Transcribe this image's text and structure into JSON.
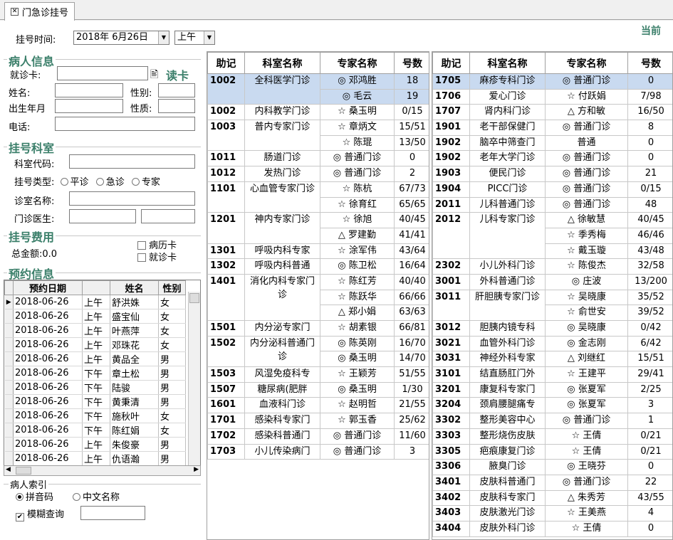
{
  "tab": {
    "title": "门急诊挂号"
  },
  "header": {
    "time_label": "挂号时间:",
    "date_value": "2018年  6月26日",
    "period_value": "上午",
    "current_label": "当前"
  },
  "patient": {
    "title": "病人信息",
    "card_label": "就诊卡:",
    "read_card": "读卡",
    "name_label": "姓名:",
    "gender_label": "性别:",
    "birth_label": "出生年月",
    "nature_label": "性质:",
    "phone_label": "电话:"
  },
  "dept": {
    "title": "挂号科室",
    "code_label": "科室代码:",
    "type_label": "挂号类型:",
    "type_options": [
      "平诊",
      "急诊",
      "专家"
    ],
    "room_label": "诊室名称:",
    "doctor_label": "门诊医生:"
  },
  "fee": {
    "title": "挂号费用",
    "total_label": "总金额:0.0",
    "chk_record": "病历卡",
    "chk_card": "就诊卡"
  },
  "appointment": {
    "title": "预约信息",
    "columns": [
      "预约日期",
      "",
      "姓名",
      "性别"
    ],
    "rows": [
      [
        "2018-06-26",
        "上午",
        "舒洪姝",
        "女"
      ],
      [
        "2018-06-26",
        "上午",
        "盛宝仙",
        "女"
      ],
      [
        "2018-06-26",
        "上午",
        "叶燕萍",
        "女"
      ],
      [
        "2018-06-26",
        "上午",
        "邓珠花",
        "女"
      ],
      [
        "2018-06-26",
        "上午",
        "黄品全",
        "男"
      ],
      [
        "2018-06-26",
        "下午",
        "章土松",
        "男"
      ],
      [
        "2018-06-26",
        "下午",
        "陆骏",
        "男"
      ],
      [
        "2018-06-26",
        "下午",
        "黄秉清",
        "男"
      ],
      [
        "2018-06-26",
        "下午",
        "施秋叶",
        "女"
      ],
      [
        "2018-06-26",
        "下午",
        "陈红娟",
        "女"
      ],
      [
        "2018-06-26",
        "上午",
        "朱俊豪",
        "男"
      ],
      [
        "2018-06-26",
        "上午",
        "仇语瀚",
        "男"
      ]
    ]
  },
  "index": {
    "title": "病人索引",
    "opt_pinyin": "拼音码",
    "opt_chinese": "中文名称",
    "fuzzy": "模糊查询"
  },
  "grid_headers": [
    "助记",
    "科室名称",
    "专家名称",
    "号数"
  ],
  "grid_left": [
    {
      "code": "1002",
      "dept": "全科医学门诊",
      "docs": [
        [
          "◎ 邓鸿胜",
          "18"
        ],
        [
          "◎ 毛云",
          "19"
        ]
      ],
      "sel": true
    },
    {
      "code": "1002",
      "dept": "内科教学门诊",
      "docs": [
        [
          "☆ 桑玉明",
          "0/15"
        ]
      ]
    },
    {
      "code": "1003",
      "dept": "普内专家门诊",
      "docs": [
        [
          "☆ 章炳文",
          "15/51"
        ],
        [
          "☆ 陈琨",
          "13/50"
        ]
      ]
    },
    {
      "code": "1011",
      "dept": "肠道门诊",
      "docs": [
        [
          "◎ 普通门诊",
          "0"
        ]
      ]
    },
    {
      "code": "1012",
      "dept": "发热门诊",
      "docs": [
        [
          "◎ 普通门诊",
          "2"
        ]
      ]
    },
    {
      "code": "1101",
      "dept": "心血管专家门诊",
      "docs": [
        [
          "☆ 陈杭",
          "67/73"
        ],
        [
          "☆ 徐育红",
          "65/65"
        ]
      ]
    },
    {
      "code": "1201",
      "dept": "神内专家门诊",
      "docs": [
        [
          "☆ 徐旭",
          "40/45"
        ],
        [
          "△ 罗建勤",
          "41/41"
        ]
      ]
    },
    {
      "code": "1301",
      "dept": "呼吸内科专家",
      "docs": [
        [
          "☆ 涂军伟",
          "43/64"
        ]
      ]
    },
    {
      "code": "1302",
      "dept": "呼吸内科普通",
      "docs": [
        [
          "◎ 陈卫松",
          "16/64"
        ]
      ]
    },
    {
      "code": "1401",
      "dept": "消化内科专家门诊",
      "docs": [
        [
          "☆ 陈红芳",
          "40/40"
        ],
        [
          "☆ 陈跃华",
          "66/66"
        ],
        [
          "△ 郑小娟",
          "63/63"
        ]
      ]
    },
    {
      "code": "1501",
      "dept": "内分泌专家门",
      "docs": [
        [
          "☆ 胡素银",
          "66/81"
        ]
      ]
    },
    {
      "code": "1502",
      "dept": "内分泌科普通门诊",
      "docs": [
        [
          "◎ 陈英刚",
          "16/70"
        ],
        [
          "◎ 桑玉明",
          "14/70"
        ]
      ]
    },
    {
      "code": "1503",
      "dept": "风湿免疫科专",
      "docs": [
        [
          "☆ 王颖芳",
          "51/55"
        ]
      ]
    },
    {
      "code": "1507",
      "dept": "糖尿病(肥胖",
      "docs": [
        [
          "◎ 桑玉明",
          "1/30"
        ]
      ]
    },
    {
      "code": "1601",
      "dept": "血液科门诊",
      "docs": [
        [
          "☆ 赵明哲",
          "21/55"
        ]
      ]
    },
    {
      "code": "1701",
      "dept": "感染科专家门",
      "docs": [
        [
          "☆ 郭玉香",
          "25/62"
        ]
      ]
    },
    {
      "code": "1702",
      "dept": "感染科普通门",
      "docs": [
        [
          "◎ 普通门诊",
          "11/60"
        ]
      ]
    },
    {
      "code": "1703",
      "dept": "小儿传染病门",
      "docs": [
        [
          "◎ 普通门诊",
          "3"
        ]
      ]
    }
  ],
  "grid_right": [
    {
      "code": "1705",
      "dept": "麻疹专科门诊",
      "docs": [
        [
          "◎ 普通门诊",
          "0"
        ]
      ],
      "sel": true
    },
    {
      "code": "1706",
      "dept": "爱心门诊",
      "docs": [
        [
          "☆ 付跃娟",
          "7/98"
        ]
      ]
    },
    {
      "code": "1707",
      "dept": "肾内科门诊",
      "docs": [
        [
          "△ 方和敏",
          "16/50"
        ]
      ]
    },
    {
      "code": "1901",
      "dept": "老干部保健门",
      "docs": [
        [
          "◎ 普通门诊",
          "8"
        ]
      ]
    },
    {
      "code": "1902",
      "dept": "脑卒中筛查门",
      "docs": [
        [
          "普通",
          "0"
        ]
      ]
    },
    {
      "code": "1902",
      "dept": "老年大学门诊",
      "docs": [
        [
          "◎ 普通门诊",
          "0"
        ]
      ]
    },
    {
      "code": "1903",
      "dept": "便民门诊",
      "docs": [
        [
          "◎ 普通门诊",
          "21"
        ]
      ]
    },
    {
      "code": "1904",
      "dept": "PICC门诊",
      "docs": [
        [
          "◎ 普通门诊",
          "0/15"
        ]
      ]
    },
    {
      "code": "2011",
      "dept": "儿科普通门诊",
      "docs": [
        [
          "◎ 普通门诊",
          "48"
        ]
      ]
    },
    {
      "code": "2012",
      "dept": "儿科专家门诊",
      "docs": [
        [
          "△ 徐敏慧",
          "40/45"
        ],
        [
          "☆ 季秀梅",
          "46/46"
        ],
        [
          "☆ 戴玉璇",
          "43/48"
        ]
      ]
    },
    {
      "code": "2302",
      "dept": "小儿外科门诊",
      "docs": [
        [
          "☆ 陈俊杰",
          "32/58"
        ]
      ]
    },
    {
      "code": "3001",
      "dept": "外科普通门诊",
      "docs": [
        [
          "◎ 庄波",
          "13/200"
        ]
      ]
    },
    {
      "code": "3011",
      "dept": "肝胆胰专家门诊",
      "docs": [
        [
          "☆ 吴晓康",
          "35/52"
        ],
        [
          "☆ 俞世安",
          "39/52"
        ]
      ]
    },
    {
      "code": "3012",
      "dept": "胆胰内镜专科",
      "docs": [
        [
          "◎ 吴晓康",
          "0/42"
        ]
      ]
    },
    {
      "code": "3021",
      "dept": "血管外科门诊",
      "docs": [
        [
          "◎ 金志刚",
          "6/42"
        ]
      ]
    },
    {
      "code": "3031",
      "dept": "神经外科专家",
      "docs": [
        [
          "△ 刘继红",
          "15/51"
        ]
      ]
    },
    {
      "code": "3101",
      "dept": "结直肠肛门外",
      "docs": [
        [
          "☆ 王建平",
          "29/41"
        ]
      ]
    },
    {
      "code": "3201",
      "dept": "康复科专家门",
      "docs": [
        [
          "◎ 张夏军",
          "2/25"
        ]
      ]
    },
    {
      "code": "3204",
      "dept": "颈肩腰腿痛专",
      "docs": [
        [
          "◎ 张夏军",
          "3"
        ]
      ]
    },
    {
      "code": "3302",
      "dept": "整形美容中心",
      "docs": [
        [
          "◎ 普通门诊",
          "1"
        ]
      ]
    },
    {
      "code": "3303",
      "dept": "整形烧伤皮肤",
      "docs": [
        [
          "☆ 王倩",
          "0/21"
        ]
      ]
    },
    {
      "code": "3305",
      "dept": "疤痕康复门诊",
      "docs": [
        [
          "☆ 王倩",
          "0/21"
        ]
      ]
    },
    {
      "code": "3306",
      "dept": "腋臭门诊",
      "docs": [
        [
          "◎ 王晓芬",
          "0"
        ]
      ]
    },
    {
      "code": "3401",
      "dept": "皮肤科普通门",
      "docs": [
        [
          "◎ 普通门诊",
          "22"
        ]
      ]
    },
    {
      "code": "3402",
      "dept": "皮肤科专家门",
      "docs": [
        [
          "△ 朱秀芳",
          "43/55"
        ]
      ]
    },
    {
      "code": "3403",
      "dept": "皮肤激光门诊",
      "docs": [
        [
          "☆ 王美燕",
          "4"
        ]
      ]
    },
    {
      "code": "3404",
      "dept": "皮肤外科门诊",
      "docs": [
        [
          "☆ 王倩",
          "0"
        ]
      ]
    }
  ],
  "colors": {
    "group_title": "#3b7f6a",
    "selected_row": "#c9daf0"
  }
}
